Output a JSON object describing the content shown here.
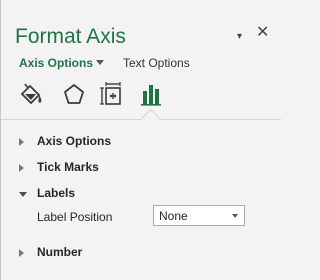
{
  "pane": {
    "title": "Format Axis",
    "dropdown_glyph": "▾",
    "close_glyph": "✕"
  },
  "option_tabs": {
    "active": "Axis Options",
    "other": "Text Options"
  },
  "icons": [
    {
      "name": "fill-line-icon"
    },
    {
      "name": "effects-icon"
    },
    {
      "name": "size-properties-icon"
    },
    {
      "name": "axis-options-icon"
    }
  ],
  "sections": {
    "axis_options": "Axis Options",
    "tick_marks": "Tick Marks",
    "labels": "Labels",
    "number": "Number"
  },
  "label_position": {
    "label": "Label Position",
    "value": "None"
  },
  "colors": {
    "accent": "#217346"
  }
}
